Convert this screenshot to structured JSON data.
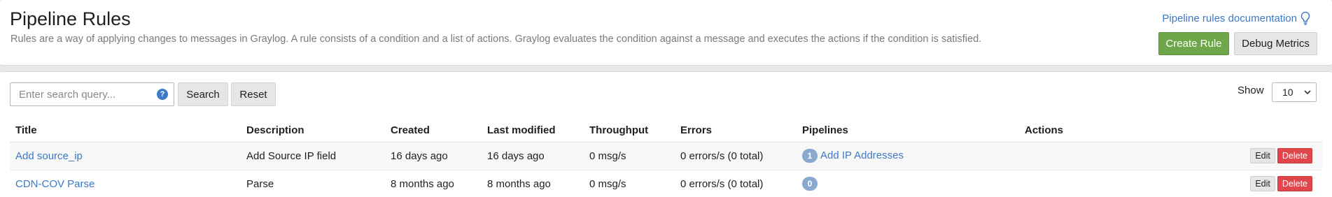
{
  "header": {
    "title": "Pipeline Rules",
    "description": "Rules are a way of applying changes to messages in Graylog. A rule consists of a condition and a list of actions. Graylog evaluates the condition against a message and executes the actions if the condition is satisfied.",
    "doc_link": "Pipeline rules documentation",
    "doc_icon": "lightbulb-icon",
    "create_label": "Create Rule",
    "debug_label": "Debug Metrics"
  },
  "search": {
    "placeholder": "Enter search query...",
    "help_glyph": "?",
    "search_label": "Search",
    "reset_label": "Reset"
  },
  "pagination": {
    "show_label": "Show",
    "page_size": "10"
  },
  "table": {
    "columns": {
      "title": "Title",
      "description": "Description",
      "created": "Created",
      "modified": "Last modified",
      "throughput": "Throughput",
      "errors": "Errors",
      "pipelines": "Pipelines",
      "actions": "Actions"
    },
    "rows": [
      {
        "title": "Add source_ip",
        "description": "Add Source IP field",
        "created": "16 days ago",
        "modified": "16 days ago",
        "throughput": "0 msg/s",
        "errors": "0 errors/s (0 total)",
        "pipeline_count": "1",
        "pipeline_name": "Add IP Addresses",
        "edit_label": "Edit",
        "delete_label": "Delete"
      },
      {
        "title": "CDN-COV Parse",
        "description": "Parse",
        "created": "8 months ago",
        "modified": "8 months ago",
        "throughput": "0 msg/s",
        "errors": "0 errors/s (0 total)",
        "pipeline_count": "0",
        "pipeline_name": "",
        "edit_label": "Edit",
        "delete_label": "Delete"
      }
    ]
  },
  "colors": {
    "accent_link": "#3c7ac5",
    "create_button": "#6ea64a",
    "delete_button": "#e0464a",
    "badge": "#8aa9d0"
  }
}
